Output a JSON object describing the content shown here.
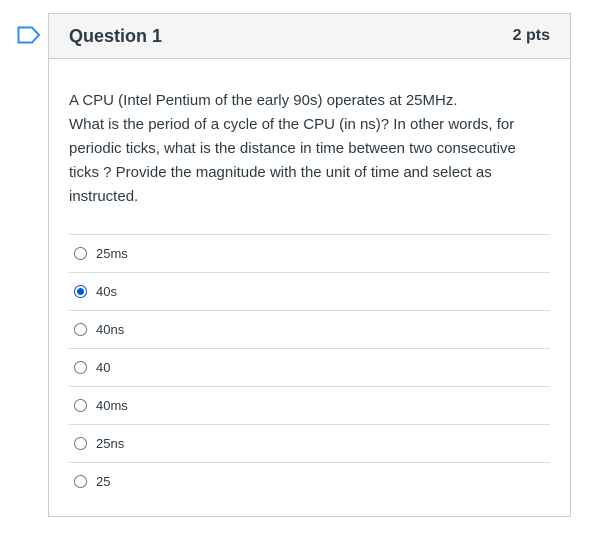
{
  "question": {
    "title": "Question 1",
    "points": "2 pts",
    "text": [
      "A CPU (Intel Pentium of the early 90s) operates at 25MHz.",
      "What is the period of a cycle of the CPU (in ns)? In other words, for",
      "periodic ticks, what is the distance in time between two consecutive",
      "ticks ? Provide the magnitude with the unit of time and select as",
      "instructed."
    ],
    "answers": [
      {
        "label": "25ms",
        "selected": false
      },
      {
        "label": "40s",
        "selected": true
      },
      {
        "label": "40ns",
        "selected": false
      },
      {
        "label": "40",
        "selected": false
      },
      {
        "label": "40ms",
        "selected": false
      },
      {
        "label": "25ns",
        "selected": false
      },
      {
        "label": "25",
        "selected": false
      }
    ]
  },
  "icons": {
    "flag": "bookmark-flag-icon"
  },
  "colors": {
    "accent": "#0b57d0",
    "flag": "#2d8cf0",
    "header_bg": "#f5f5f5"
  }
}
